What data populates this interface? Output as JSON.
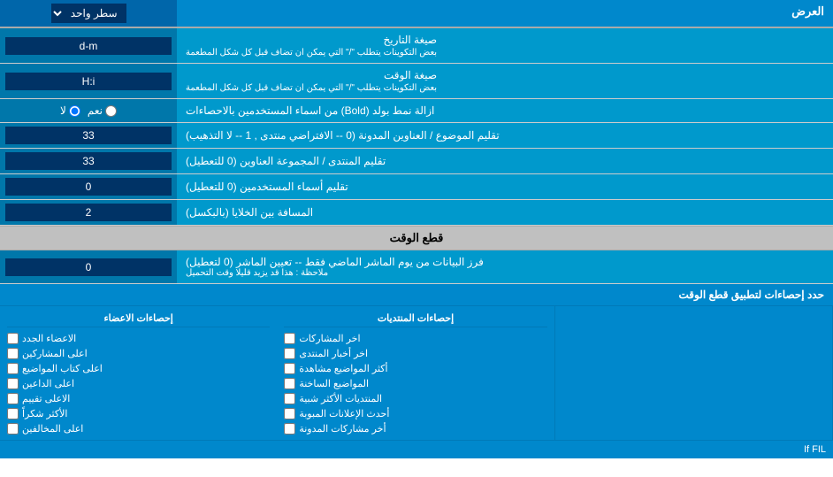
{
  "header": {
    "display_label": "العرض",
    "display_input_options": [
      "سطر واحد"
    ],
    "display_selected": "سطر واحد"
  },
  "date_format": {
    "label": "صيغة التاريخ",
    "sublabel": "بعض التكوينات يتطلب \"/\" التي يمكن ان تضاف قبل كل شكل المطعمة",
    "value": "d-m"
  },
  "time_format": {
    "label": "صيغة الوقت",
    "sublabel": "بعض التكوينات يتطلب \"/\" التي يمكن ان تضاف قبل كل شكل المطعمة",
    "value": "H:i"
  },
  "bold_remove": {
    "label": "ازالة نمط بولد (Bold) من اسماء المستخدمين بالاحصاءات",
    "option_yes": "نعم",
    "option_no": "لا",
    "selected": "no"
  },
  "subject_titles": {
    "label": "تقليم الموضوع / العناوين المدونة (0 -- الافتراضي منتدى , 1 -- لا التذهيب)",
    "value": "33"
  },
  "forum_titles": {
    "label": "تقليم المنتدى / المجموعة العناوين (0 للتعطيل)",
    "value": "33"
  },
  "user_names": {
    "label": "تقليم أسماء المستخدمين (0 للتعطيل)",
    "value": "0"
  },
  "cell_spacing": {
    "label": "المسافة بين الخلايا (بالبكسل)",
    "value": "2"
  },
  "cutoff_section": {
    "title": "قطع الوقت"
  },
  "cutoff_days": {
    "label": "فرز البيانات من يوم الماشر الماضي فقط -- تعيين الماشر (0 لتعطيل)",
    "sublabel": "ملاحظة : هذا قد يزيد قليلا وقت التحميل",
    "value": "0"
  },
  "apply_stats": {
    "label": "حدد إحصاءات لتطبيق قطع الوقت"
  },
  "col1_title": "إحصاءات المنتديات",
  "col1_items": [
    "اخر المشاركات",
    "اخر أخبار المنتدى",
    "أكثر المواضيع مشاهدة",
    "المواضيع الساخنة",
    "المنتديات الأكثر شبية",
    "أحدث الإعلانات المبوبة",
    "أخر مشاركات المدونة"
  ],
  "col2_title": "إحصاءات الاعضاء",
  "col2_items": [
    "الاعضاء الجدد",
    "اعلى المشاركين",
    "اعلى كتاب المواضيع",
    "اعلى الداعين",
    "الاعلى تقييم",
    "الأكثر شكراً",
    "اعلى المخالفين"
  ],
  "bottom_note": "If FIL",
  "icons": {
    "dropdown_arrow": "▼",
    "checkbox_checked": "☑",
    "checkbox_unchecked": "☐",
    "radio_selected": "●",
    "radio_unselected": "○"
  }
}
